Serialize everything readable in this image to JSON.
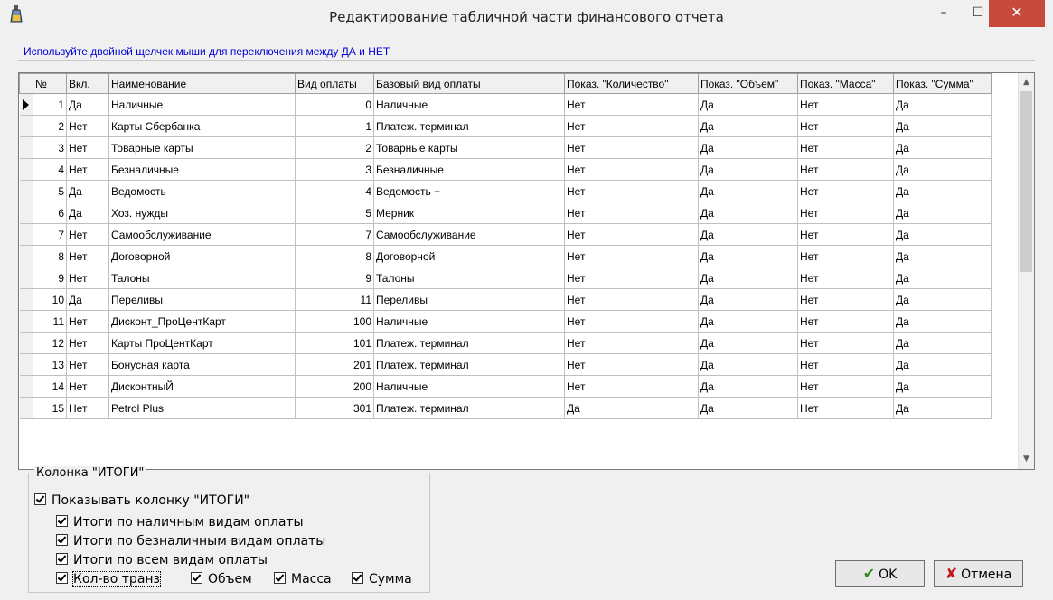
{
  "window": {
    "title": "Редактирование табличной части финансового отчета",
    "minimize": "–",
    "maximize": "☐",
    "close": "✕"
  },
  "hint": "Используйте двойной щелчек мыши для переключения между ДА и НЕТ",
  "grid": {
    "columns": [
      "№",
      "Вкл.",
      "Наименование",
      "Вид оплаты",
      "Базовый вид оплаты",
      "Показ. \"Количество\"",
      "Показ. \"Объем\"",
      "Показ. \"Масса\"",
      "Показ. \"Сумма\""
    ],
    "rows": [
      [
        "1",
        "Да",
        "Наличные",
        "0",
        "Наличные",
        "Нет",
        "Да",
        "Нет",
        "Да"
      ],
      [
        "2",
        "Нет",
        "Карты Сбербанка",
        "1",
        "Платеж. терминал",
        "Нет",
        "Да",
        "Нет",
        "Да"
      ],
      [
        "3",
        "Нет",
        "Товарные карты",
        "2",
        "Товарные карты",
        "Нет",
        "Да",
        "Нет",
        "Да"
      ],
      [
        "4",
        "Нет",
        "Безналичные",
        "3",
        "Безналичные",
        "Нет",
        "Да",
        "Нет",
        "Да"
      ],
      [
        "5",
        "Да",
        "Ведомость",
        "4",
        "Ведомость +",
        "Нет",
        "Да",
        "Нет",
        "Да"
      ],
      [
        "6",
        "Да",
        "Хоз. нужды",
        "5",
        "Мерник",
        "Нет",
        "Да",
        "Нет",
        "Да"
      ],
      [
        "7",
        "Нет",
        "Самообслуживание",
        "7",
        "Самообслуживание",
        "Нет",
        "Да",
        "Нет",
        "Да"
      ],
      [
        "8",
        "Нет",
        "Договорной",
        "8",
        "Договорной",
        "Нет",
        "Да",
        "Нет",
        "Да"
      ],
      [
        "9",
        "Нет",
        "Талоны",
        "9",
        "Талоны",
        "Нет",
        "Да",
        "Нет",
        "Да"
      ],
      [
        "10",
        "Да",
        "Переливы",
        "11",
        "Переливы",
        "Нет",
        "Да",
        "Нет",
        "Да"
      ],
      [
        "11",
        "Нет",
        "Дисконт_ПроЦентКарт",
        "100",
        "Наличные",
        "Нет",
        "Да",
        "Нет",
        "Да"
      ],
      [
        "12",
        "Нет",
        "Карты ПроЦентКарт",
        "101",
        "Платеж. терминал",
        "Нет",
        "Да",
        "Нет",
        "Да"
      ],
      [
        "13",
        "Нет",
        "Бонусная карта",
        "201",
        "Платеж. терминал",
        "Нет",
        "Да",
        "Нет",
        "Да"
      ],
      [
        "14",
        "Нет",
        "ДисконтныЙ",
        "200",
        "Наличные",
        "Нет",
        "Да",
        "Нет",
        "Да"
      ],
      [
        "15",
        "Нет",
        "Petrol Plus",
        "301",
        "Платеж. терминал",
        "Да",
        "Да",
        "Нет",
        "Да"
      ]
    ],
    "scroll_up": "▲",
    "scroll_down": "▼"
  },
  "totals": {
    "legend": "Колонка \"ИТОГИ\"",
    "show_totals": "Показывать колонку \"ИТОГИ\"",
    "cash": "Итоги по наличным видам оплаты",
    "noncash": "Итоги по безналичным видам оплаты",
    "all": "Итоги по всем видам оплаты",
    "count": "Кол-во транз",
    "volume": "Объем",
    "mass": "Масса",
    "sum": "Сумма"
  },
  "buttons": {
    "ok": "OK",
    "cancel": "Отмена"
  }
}
